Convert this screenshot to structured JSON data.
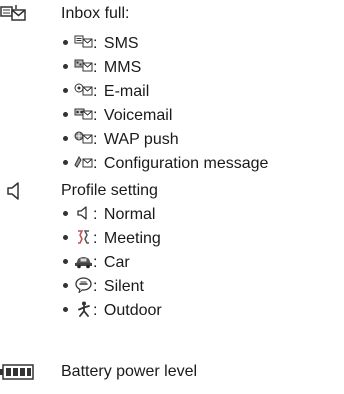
{
  "inbox": {
    "label": "Inbox full:",
    "icon": "envelope-stack-icon",
    "items": [
      {
        "icon": "sms-envelope-icon",
        "label": "SMS"
      },
      {
        "icon": "mms-envelope-icon",
        "label": "MMS"
      },
      {
        "icon": "email-envelope-icon",
        "label": "E-mail"
      },
      {
        "icon": "voicemail-envelope-icon",
        "label": "Voicemail"
      },
      {
        "icon": "wap-push-envelope-icon",
        "label": "WAP push"
      },
      {
        "icon": "configuration-envelope-icon",
        "label": "Configuration message"
      }
    ]
  },
  "profile": {
    "label": "Profile setting",
    "icon": "speaker-icon",
    "items": [
      {
        "icon": "speaker-icon",
        "label": "Normal"
      },
      {
        "icon": "meeting-icon",
        "label": "Meeting"
      },
      {
        "icon": "car-icon",
        "label": "Car"
      },
      {
        "icon": "silent-bubble-icon",
        "label": "Silent"
      },
      {
        "icon": "outdoor-person-icon",
        "label": "Outdoor"
      }
    ]
  },
  "battery": {
    "label": "Battery power level",
    "icon": "battery-icon"
  },
  "colors": {
    "icon_dark": "#333333",
    "icon_light": "#9a9a9a"
  }
}
